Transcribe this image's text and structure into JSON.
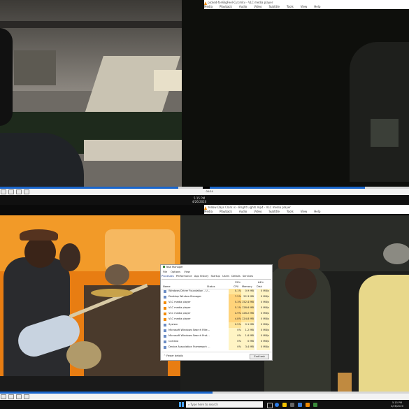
{
  "top_player": {
    "title": "picked-for-BigFeel-Cut.mkv - VLC media player",
    "menu": [
      "Media",
      "Playback",
      "Audio",
      "Video",
      "Subtitle",
      "Tools",
      "View",
      "Help"
    ],
    "time": "00:24",
    "progress": 0.88
  },
  "top_taskbar": {
    "time": "5:15 PM",
    "date": "4/26/2020"
  },
  "bottom_player": {
    "title": "Yellow Days Clark is - Bright Lights.mp4 - VLC media player",
    "menu": [
      "Media",
      "Playback",
      "Audio",
      "Video",
      "Subtitle",
      "Tools",
      "View",
      "Help"
    ]
  },
  "task_manager": {
    "title": "Task Manager",
    "menu": [
      "File",
      "Options",
      "View"
    ],
    "tabs": [
      "Processes",
      "Performance",
      "App history",
      "Startup",
      "Users",
      "Details",
      "Services"
    ],
    "totals": {
      "cpu": "35%",
      "memory": "64%"
    },
    "columns": [
      "Name",
      "Status",
      "CPU",
      "Memory",
      "Disk"
    ],
    "rows": [
      {
        "name": "Windows Driver Foundation - U...",
        "cpu": "0.1%",
        "mem": "0.9 MB",
        "disk": "0 MB/s"
      },
      {
        "name": "Desktop Window Manager",
        "cpu": "7.2%",
        "mem": "52.3 MB",
        "disk": "0 MB/s"
      },
      {
        "name": "VLC media player",
        "cpu": "5.3%",
        "mem": "152.4 MB",
        "disk": "0 MB/s"
      },
      {
        "name": "VLC media player",
        "cpu": "5.1%",
        "mem": "128.6 MB",
        "disk": "0 MB/s"
      },
      {
        "name": "VLC media player",
        "cpu": "4.9%",
        "mem": "126.2 MB",
        "disk": "0 MB/s"
      },
      {
        "name": "VLC media player",
        "cpu": "4.8%",
        "mem": "124.8 MB",
        "disk": "0 MB/s"
      },
      {
        "name": "System",
        "cpu": "0.5%",
        "mem": "0.1 MB",
        "disk": "0 MB/s"
      },
      {
        "name": "Microsoft Windows Search Filte...",
        "cpu": "0%",
        "mem": "1.2 MB",
        "disk": "0 MB/s"
      },
      {
        "name": "Microsoft Windows Search Prot...",
        "cpu": "0%",
        "mem": "1.6 MB",
        "disk": "0 MB/s"
      },
      {
        "name": "Cortana",
        "cpu": "0%",
        "mem": "0 MB",
        "disk": "0 MB/s"
      },
      {
        "name": "Device Association Framework ...",
        "cpu": "0%",
        "mem": "3.4 MB",
        "disk": "0 MB/s"
      }
    ],
    "fewer_details": "Fewer details",
    "end_task": "End task"
  },
  "bottom_taskbar": {
    "search_placeholder": "Type here to search",
    "time": "5:15 PM",
    "date": "4/26/2020"
  },
  "colors": {
    "vlc_orange": "#f28a00",
    "seek_blue": "#1a66cc"
  }
}
